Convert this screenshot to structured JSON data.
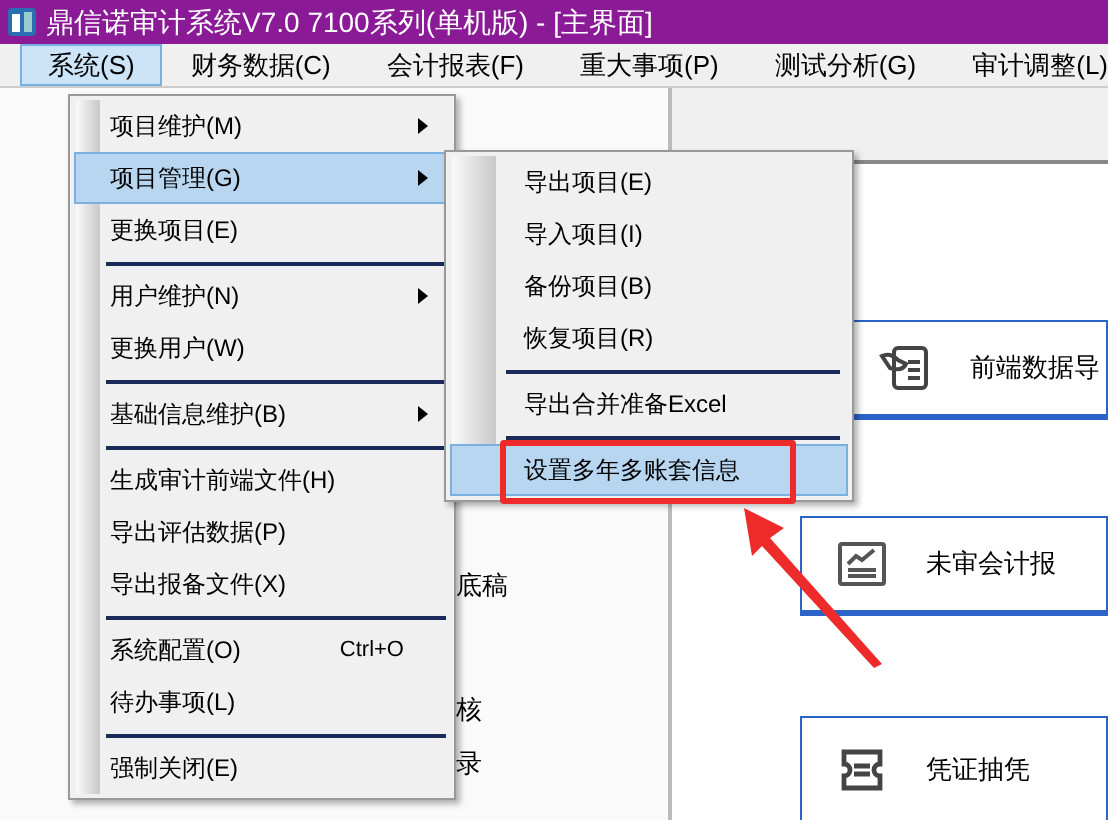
{
  "window": {
    "title": "鼎信诺审计系统V7.0 7100系列(单机版) - [主界面]"
  },
  "menu_bar": [
    {
      "label": "系统(S)",
      "selected": true
    },
    {
      "label": "财务数据(C)",
      "selected": false
    },
    {
      "label": "会计报表(F)",
      "selected": false
    },
    {
      "label": "重大事项(P)",
      "selected": false
    },
    {
      "label": "测试分析(G)",
      "selected": false
    },
    {
      "label": "审计调整(L)",
      "selected": false
    }
  ],
  "system_menu": [
    {
      "kind": "item",
      "label": "项目维护(M)",
      "has_submenu": true,
      "selected": false
    },
    {
      "kind": "item",
      "label": "项目管理(G)",
      "has_submenu": true,
      "selected": true
    },
    {
      "kind": "item",
      "label": "更换项目(E)",
      "has_submenu": false,
      "selected": false
    },
    {
      "kind": "separator"
    },
    {
      "kind": "item",
      "label": "用户维护(N)",
      "has_submenu": true,
      "selected": false
    },
    {
      "kind": "item",
      "label": "更换用户(W)",
      "has_submenu": false,
      "selected": false
    },
    {
      "kind": "separator"
    },
    {
      "kind": "item",
      "label": "基础信息维护(B)",
      "has_submenu": true,
      "selected": false
    },
    {
      "kind": "separator"
    },
    {
      "kind": "item",
      "label": "生成审计前端文件(H)",
      "has_submenu": false,
      "selected": false
    },
    {
      "kind": "item",
      "label": "导出评估数据(P)",
      "has_submenu": false,
      "selected": false
    },
    {
      "kind": "item",
      "label": "导出报备文件(X)",
      "has_submenu": false,
      "selected": false
    },
    {
      "kind": "separator"
    },
    {
      "kind": "item",
      "label": "系统配置(O)",
      "shortcut": "Ctrl+O",
      "has_submenu": false,
      "selected": false
    },
    {
      "kind": "item",
      "label": "待办事项(L)",
      "has_submenu": false,
      "selected": false
    },
    {
      "kind": "separator"
    },
    {
      "kind": "item",
      "label": "强制关闭(E)",
      "has_submenu": false,
      "selected": false
    }
  ],
  "project_submenu": [
    {
      "kind": "item",
      "label": "导出项目(E)",
      "selected": false
    },
    {
      "kind": "item",
      "label": "导入项目(I)",
      "selected": false
    },
    {
      "kind": "item",
      "label": "备份项目(B)",
      "selected": false
    },
    {
      "kind": "item",
      "label": "恢复项目(R)",
      "selected": false
    },
    {
      "kind": "separator"
    },
    {
      "kind": "item",
      "label": "导出合并准备Excel",
      "selected": false
    },
    {
      "kind": "separator"
    },
    {
      "kind": "item",
      "label": "设置多年多账套信息",
      "selected": true
    }
  ],
  "left_panel": [
    {
      "text": "底稿"
    },
    {
      "text": "核"
    },
    {
      "text": "录"
    }
  ],
  "cards": [
    {
      "kind": "import",
      "label": "前端数据导"
    },
    {
      "kind": "report",
      "label": "未审会计报"
    },
    {
      "kind": "voucher",
      "label": "凭证抽凭"
    }
  ]
}
